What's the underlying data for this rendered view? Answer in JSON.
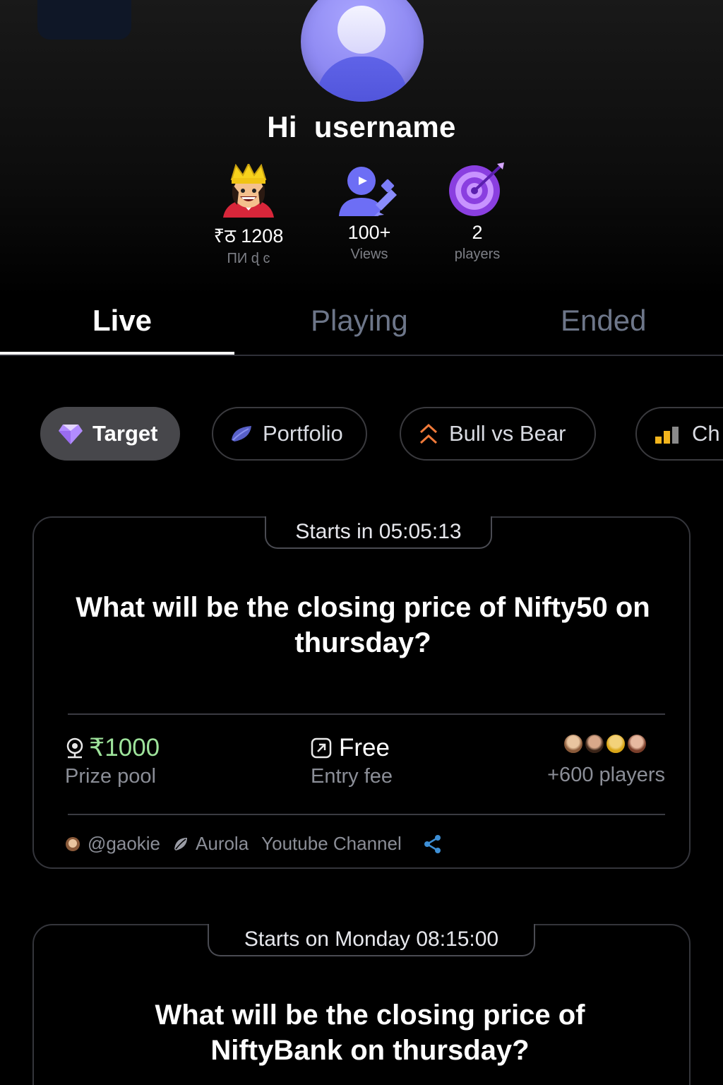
{
  "header": {
    "greeting_hi": "Hi",
    "greeting_name": "username"
  },
  "stats": [
    {
      "icon": "king-emoji-icon",
      "value": "₹ठ 1208",
      "label": "ПИ ɖ ͼ"
    },
    {
      "icon": "user-video-icon",
      "value": "100+",
      "label": "Views"
    },
    {
      "icon": "target-icon",
      "value": "2",
      "label": "players"
    }
  ],
  "tabs": [
    {
      "label": "Live",
      "active": true
    },
    {
      "label": "Playing",
      "active": false
    },
    {
      "label": "Ended",
      "active": false
    }
  ],
  "categories": [
    {
      "label": "Target",
      "icon": "diamond-icon",
      "active": true
    },
    {
      "label": "Portfolio",
      "icon": "leaf-icon",
      "active": false
    },
    {
      "label": "Bull vs Bear",
      "icon": "arrows-icon",
      "active": false
    },
    {
      "label": "Ch",
      "icon": "bar-chart-icon",
      "active": false
    }
  ],
  "cards": [
    {
      "timer": "Starts in 05:05:13",
      "question": "What will be the closing price of Nifty50 on thursday?",
      "prize_value": "₹1000",
      "prize_label": "Prize pool",
      "fee_value": "Free",
      "fee_label": "Entry fee",
      "players_label": "+600 players",
      "creator": "@gaokie",
      "sponsor": "Aurola",
      "channel": "Youtube Channel"
    },
    {
      "timer": "Starts on Monday 08:15:00",
      "question": "What will be the closing price of NiftyBank on thursday?"
    }
  ],
  "colors": {
    "accent_green": "#9ee39b",
    "avatar_purple": "#8e89f2",
    "tab_inactive": "#6d7689",
    "share_blue": "#3d8fd6"
  }
}
